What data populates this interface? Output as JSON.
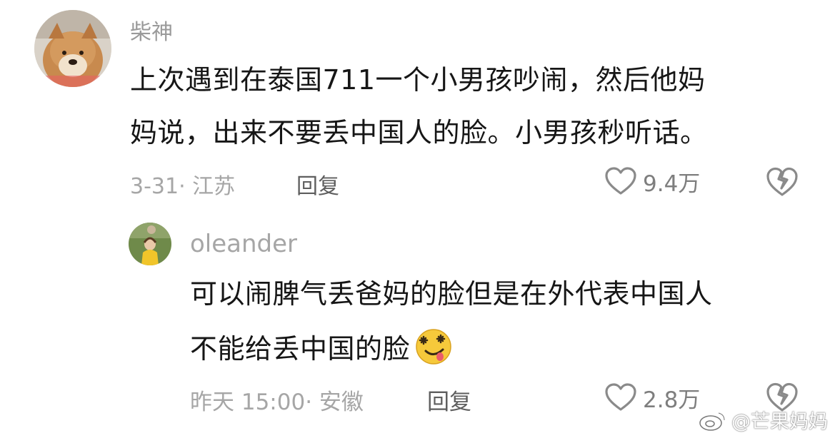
{
  "comments": [
    {
      "username": "柴神",
      "lines": [
        "上次遇到在泰国711一个小男孩吵闹，然后他妈",
        "妈说，出来不要丢中国人的脸。小男孩秒听话。"
      ],
      "meta": "3-31· 江苏",
      "reply_label": "回复",
      "likes": "9.4万",
      "avatar_icon": "shiba-dog-avatar-icon"
    },
    {
      "username": "oleander",
      "lines": [
        "可以闹脾气丢爸妈的脸但是在外代表中国人",
        "不能给丢中国的脸"
      ],
      "emoji": "dizzy-tongue-face-emoji-icon",
      "meta": "昨天 15:00· 安徽",
      "reply_label": "回复",
      "likes": "2.8万",
      "avatar_icon": "child-yellow-raincoat-avatar-icon"
    }
  ],
  "watermark": "@芒果妈妈",
  "colors": {
    "username": "#9a9a9a",
    "text": "#161616",
    "meta": "#a6a6a6",
    "icon": "#8a8a8a"
  }
}
